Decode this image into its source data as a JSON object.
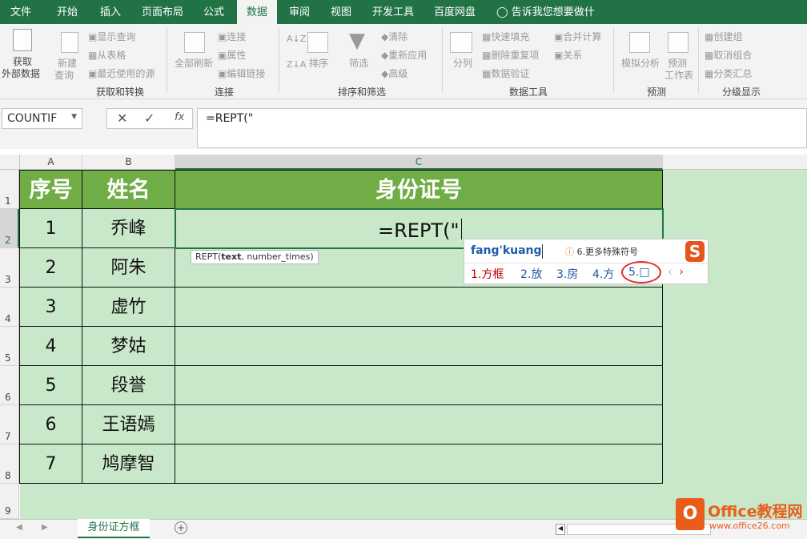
{
  "tabs": [
    "文件",
    "开始",
    "插入",
    "页面布局",
    "公式",
    "数据",
    "审阅",
    "视图",
    "开发工具",
    "百度网盘"
  ],
  "active_tab": "数据",
  "tellme": "告诉我您想要做什么...",
  "ribbon": {
    "get_data": [
      "获取",
      "外部数据"
    ],
    "new_query": [
      "新建",
      "查询"
    ],
    "show_query": "显示查询",
    "from_table": "从表格",
    "recent_sources": "最近使用的源",
    "group_get": "获取和转换",
    "refresh_all": "全部刷新",
    "connections": "连接",
    "properties": "属性",
    "edit_links": "编辑链接",
    "group_conn": "连接",
    "sort": "排序",
    "filter": "筛选",
    "clear": "清除",
    "reapply": "重新应用",
    "advanced": "高级",
    "group_sort": "排序和筛选",
    "split": "分列",
    "flash_fill": "快速填充",
    "remove_dup": "删除重复项",
    "validation": "数据验证",
    "consolidate": "合并计算",
    "relationships": "关系",
    "group_tools": "数据工具",
    "whatif": "模拟分析",
    "forecast": [
      "预测",
      "工作表"
    ],
    "group_forecast": "预测",
    "group_create": "创建组",
    "ungroup": "取消组合",
    "subtotal": "分类汇总",
    "group_outline": "分级显示"
  },
  "namebox": "COUNTIF",
  "formula": "=REPT(\"",
  "columns": [
    "A",
    "B",
    "C"
  ],
  "rows": [
    "1",
    "2",
    "3",
    "4",
    "5",
    "6",
    "7",
    "8",
    "9"
  ],
  "header_row": [
    "序号",
    "姓名",
    "身份证号"
  ],
  "data_rows": [
    [
      "1",
      "乔峰"
    ],
    [
      "2",
      "阿朱"
    ],
    [
      "3",
      "虚竹"
    ],
    [
      "4",
      "梦姑"
    ],
    [
      "5",
      "段誉"
    ],
    [
      "6",
      "王语嫣"
    ],
    [
      "7",
      "鸠摩智"
    ]
  ],
  "editing_cell": "=REPT(\"",
  "tooltip": {
    "fn": "REPT(",
    "arg1": "text",
    ",rest": "",
    "rest": ", number_times)"
  },
  "ime": {
    "pinyin": "fang'kuang",
    "more": "6.更多特殊符号",
    "candidates": [
      "1.方框",
      "2.放",
      "3.房",
      "4.方",
      "5.□"
    ]
  },
  "sheet_tab": "身份证方框",
  "logo": {
    "text": "Office教程网",
    "url": "www.office26.com"
  },
  "colors": {
    "accent": "#217346",
    "header_fill": "#70ad47",
    "cell_fill": "#c9e8c9"
  }
}
